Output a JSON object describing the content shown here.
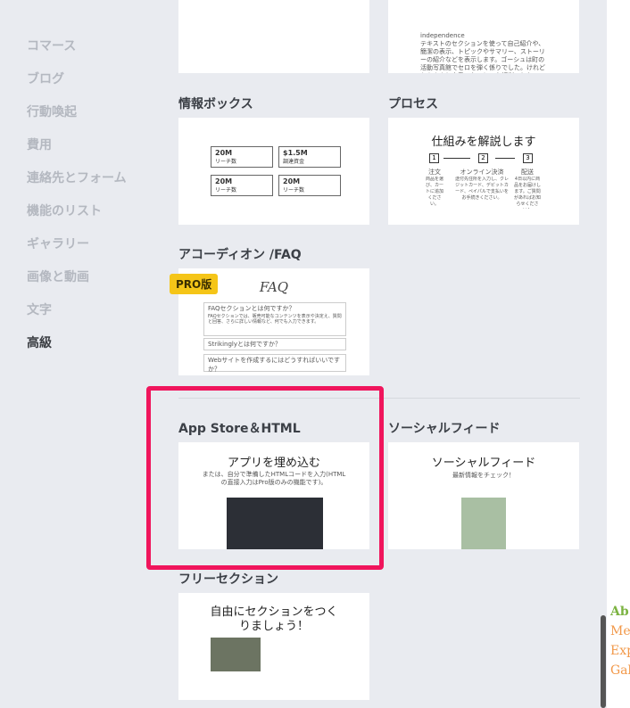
{
  "sidebar": {
    "items": [
      {
        "label": "コマース"
      },
      {
        "label": "ブログ"
      },
      {
        "label": "行動喚起"
      },
      {
        "label": "費用"
      },
      {
        "label": "連絡先とフォーム"
      },
      {
        "label": "機能のリスト"
      },
      {
        "label": "ギャラリー"
      },
      {
        "label": "画像と動画"
      },
      {
        "label": "文字"
      },
      {
        "label": "高級"
      }
    ]
  },
  "top_cards": {
    "right_text": "independence\nテキストのセクションを使って自己紹介や、簡潔の表示、トピックやサマリー、ストーリーの紹介などを表示します。ゴーシュは町の活動写真館でセロを弾く係りでした。けれどもあんまり上手でないという評判でした。"
  },
  "sections": {
    "info_box": {
      "title": "情報ボックス",
      "boxes": [
        {
          "value": "20M",
          "caption": "リーチ数"
        },
        {
          "value": "$1.5M",
          "caption": "調達資金"
        },
        {
          "value": "20M",
          "caption": "リーチ数"
        },
        {
          "value": "20M",
          "caption": "リーチ数"
        }
      ]
    },
    "process": {
      "title": "プロセス",
      "heading": "仕組みを解説します",
      "steps": [
        {
          "num": "1",
          "label": "注文",
          "desc": "商品を選び、カートに追加ください。"
        },
        {
          "num": "2",
          "label": "オンライン決済",
          "desc": "送付先住所を入力し、クレジットカード、デビットカード、ペイパルで支払いをお手続きください。"
        },
        {
          "num": "3",
          "label": "配送",
          "desc": "4日以内に商品をお届けします。ご質問があればお知らせください！"
        }
      ]
    },
    "faq": {
      "title": "アコーディオン /FAQ",
      "badge": "PRO版",
      "heading": "FAQ",
      "q1": "FAQセクションとは何ですか？",
      "a1": "FAQセクションでは、販売可能なコンテンツを表示や決定え、質問と回答、さらに詳しい情報など、何でも入力できます。",
      "q2": "Strikinglyとは何ですか？",
      "q3": "Webサイトを作成するにはどうすればいいですか？"
    },
    "app_store": {
      "title": "App Store＆HTML",
      "heading": "アプリを埋め込む",
      "desc": "または、自分で準備したHTMLコードを入力(HTMLの直接入力はPro版のみの機能です)。"
    },
    "social": {
      "title": "ソーシャルフィード",
      "heading": "ソーシャルフィード",
      "sub": "最新情報をチェック！"
    },
    "free": {
      "title": "フリーセクション",
      "heading": "自由にセクションをつくりましょう！"
    }
  },
  "right_panel": {
    "lines": [
      "Ab",
      "Me",
      "Exp",
      "Gal"
    ],
    "colors": {
      "green": "#7cb342",
      "orange": "#f2994a"
    }
  },
  "accent": "#f0155c"
}
